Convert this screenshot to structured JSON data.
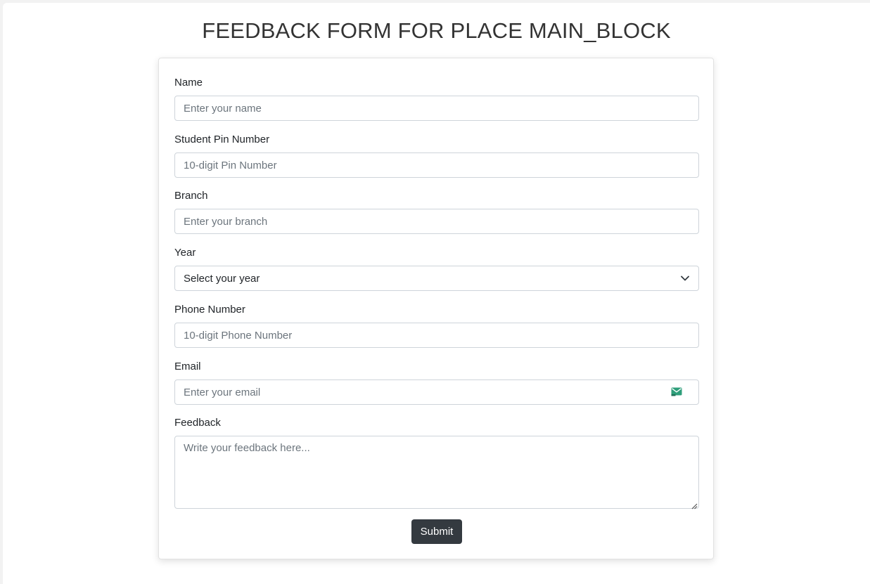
{
  "page": {
    "title": "FEEDBACK FORM FOR PLACE MAIN_BLOCK"
  },
  "form": {
    "fields": [
      {
        "label": "Name",
        "placeholder": "Enter your name",
        "value": ""
      },
      {
        "label": "Student Pin Number",
        "placeholder": "10-digit Pin Number",
        "value": ""
      },
      {
        "label": "Branch",
        "placeholder": "Enter your branch",
        "value": ""
      },
      {
        "label": "Year",
        "selected": "Select your year"
      },
      {
        "label": "Phone Number",
        "placeholder": "10-digit Phone Number",
        "value": ""
      },
      {
        "label": "Email",
        "placeholder": "Enter your email",
        "value": "",
        "icon": "email-icon"
      },
      {
        "label": "Feedback",
        "placeholder": "Write your feedback here...",
        "value": ""
      }
    ],
    "submit_label": "Submit"
  },
  "colors": {
    "submit_bg": "#343a40",
    "email_icon": "#2e9e7a"
  }
}
